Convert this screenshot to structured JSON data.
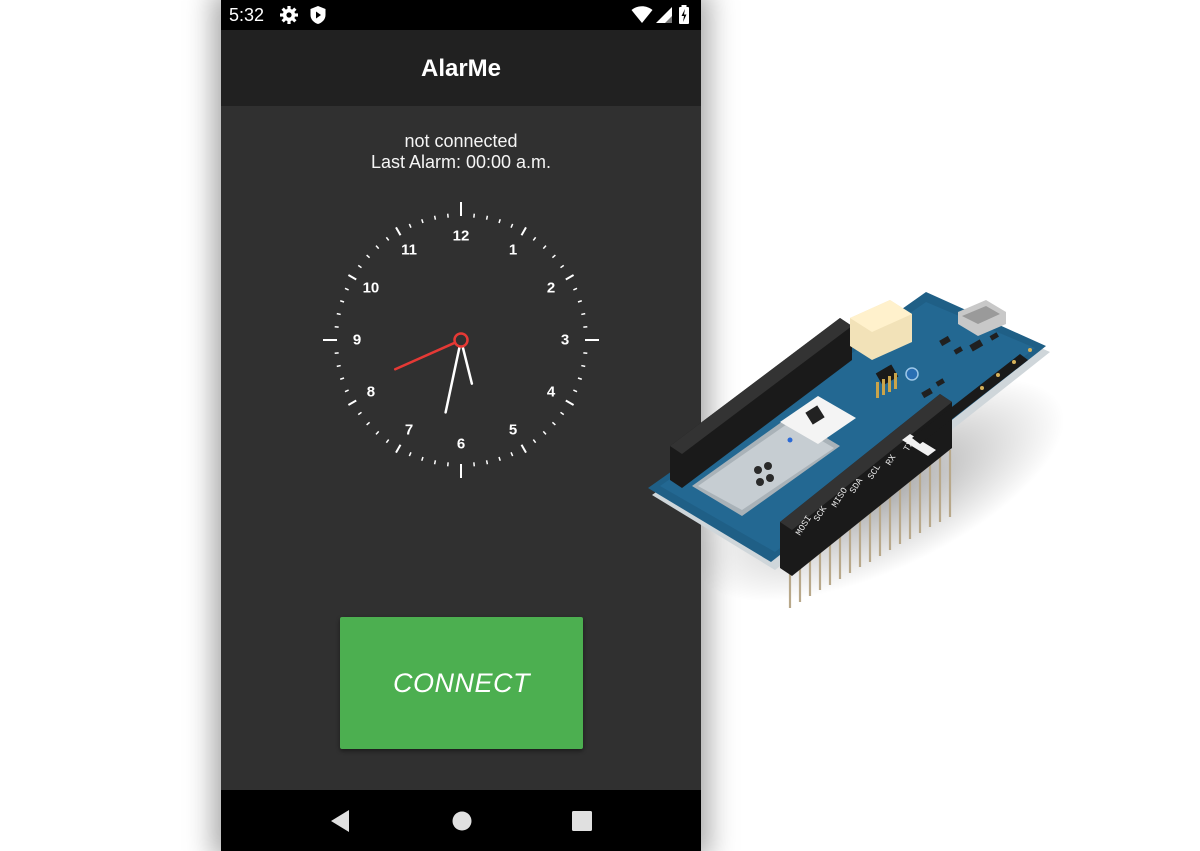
{
  "status_bar": {
    "time": "5:32",
    "left_icons": [
      "gear-icon",
      "shield-icon"
    ],
    "right_icons": [
      "wifi-icon",
      "signal-icon",
      "battery-charging-icon"
    ]
  },
  "app_bar": {
    "title": "AlarMe"
  },
  "connection": {
    "status": "not connected",
    "last_alarm": "Last Alarm: 00:00 a.m."
  },
  "clock": {
    "numbers": [
      "12",
      "1",
      "2",
      "3",
      "4",
      "5",
      "6",
      "7",
      "8",
      "9",
      "10",
      "11"
    ],
    "time_shown": {
      "hour": 5,
      "minute": 32
    },
    "red_hand_value_minutes": 41,
    "colors": {
      "hands": "#ffffff",
      "second_hand": "#e53935",
      "ticks": "#ffffff"
    }
  },
  "connect_button": {
    "label": "CONNECT",
    "color": "#4caf50"
  },
  "nav_bar": {
    "buttons": [
      "back-icon",
      "home-icon",
      "recents-icon"
    ]
  },
  "side_image": {
    "subject": "arduino-mkr-board"
  },
  "colors": {
    "background": "#303030",
    "app_bar": "#212121",
    "status_bar": "#000000",
    "accent": "#4caf50"
  }
}
